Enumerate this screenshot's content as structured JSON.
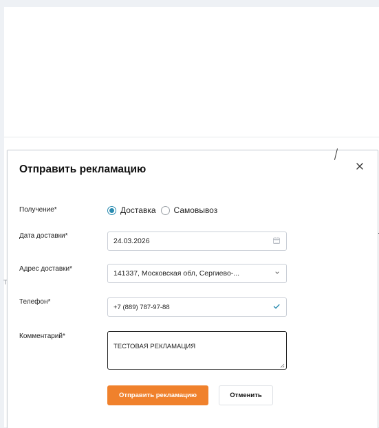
{
  "dialog": {
    "title": "Отправить рекламацию"
  },
  "form": {
    "delivery_method": {
      "label": "Получение*",
      "options": [
        "Доставка",
        "Самовывоз"
      ],
      "selected": "Доставка"
    },
    "delivery_date": {
      "label": "Дата доставки*",
      "value": "24.03.2026"
    },
    "delivery_address": {
      "label": "Адрес доставки*",
      "value": "141337, Московская обл, Сергиево-..."
    },
    "phone": {
      "label": "Телефон*",
      "value": "+7 (889) 787-97-88"
    },
    "comment": {
      "label": "Комментарий*",
      "value": "ТЕСТОВАЯ РЕКЛАМАЦИЯ"
    }
  },
  "actions": {
    "submit_label": "Отправить рекламацию",
    "cancel_label": "Отменить"
  },
  "colors": {
    "accent": "#f0812c",
    "radio": "#2a8bb0",
    "check": "#2a8bb0"
  }
}
